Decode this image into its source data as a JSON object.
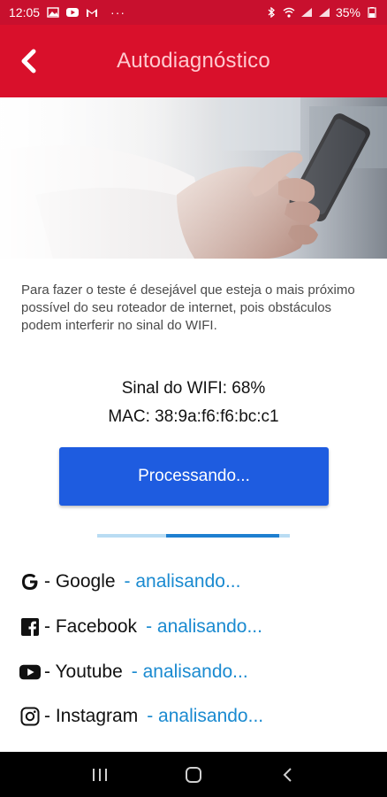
{
  "status_bar": {
    "time": "12:05",
    "dots": "···",
    "battery": "35%",
    "left_icons": [
      "image-icon",
      "youtube-notification-icon",
      "gmail-icon"
    ],
    "right_icons": [
      "bluetooth-icon",
      "wifi-icon",
      "signal-icon",
      "signal-icon",
      "battery-icon"
    ]
  },
  "app_bar": {
    "title": "Autodiagnóstico",
    "back_icon": "chevron-left-icon",
    "color": "#d9102b"
  },
  "hero": {
    "icon": "hand-holding-phone-image"
  },
  "instructions": {
    "text": "Para fazer o teste é desejável que esteja o mais próximo possível do seu roteador de internet, pois obstáculos podem interferir no sinal do WIFI."
  },
  "wifi": {
    "signal_text": "Sinal do WIFI: 68%",
    "mac_text": "MAC: 38:9a:f6:f6:bc:c1"
  },
  "process_button": {
    "label": "Processando...",
    "color": "#1e5ce0"
  },
  "progress": {
    "value_fraction": 0.59,
    "indeterminate": true
  },
  "services": [
    {
      "icon": "google-icon",
      "name": "- Google",
      "status": "- analisando..."
    },
    {
      "icon": "facebook-icon",
      "name": "- Facebook",
      "status": "- analisando..."
    },
    {
      "icon": "youtube-icon",
      "name": "- Youtube",
      "status": "- analisando..."
    },
    {
      "icon": "instagram-icon",
      "name": "- Instagram",
      "status": "- analisando..."
    }
  ],
  "nav_bar": {
    "icons": [
      "recent-apps-icon",
      "home-icon",
      "back-icon"
    ]
  }
}
